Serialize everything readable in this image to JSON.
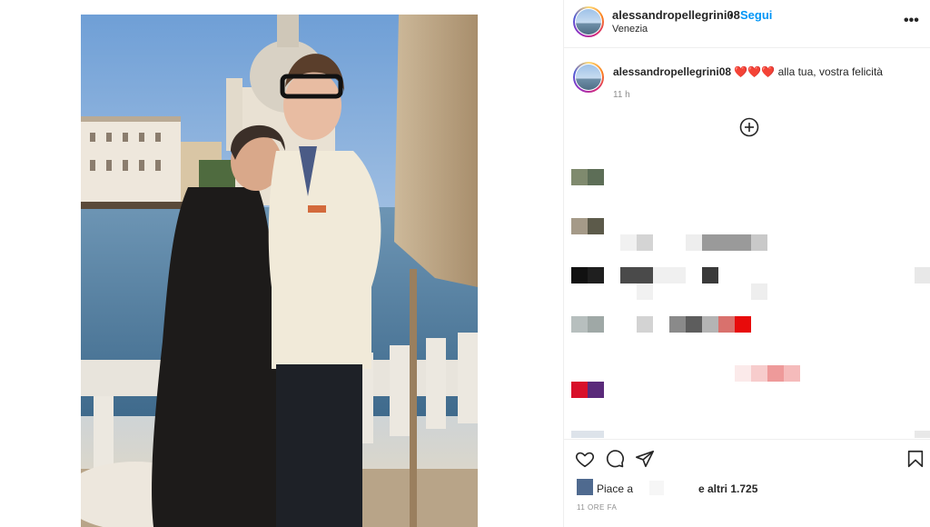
{
  "post": {
    "username": "alessandropellegrini08",
    "separator": "•",
    "follow_label": "Segui",
    "location": "Venezia",
    "more_label": "•••"
  },
  "caption": {
    "username": "alessandropellegrini08",
    "hearts": "❤️❤️❤️",
    "text": "alla tua, vostra felicità",
    "time": "11 h"
  },
  "actions": {
    "likes_prefix": "Piace a",
    "likes_suffix": "e altri 1.725",
    "posted_time": "11 ORE FA"
  },
  "icons": {
    "like": "heart-icon",
    "comment": "comment-icon",
    "share": "paper-plane-icon",
    "save": "bookmark-icon",
    "load_more": "plus-circle-icon"
  },
  "colors": {
    "follow": "#0095f6",
    "text": "#262626",
    "muted": "#8e8e8e"
  }
}
